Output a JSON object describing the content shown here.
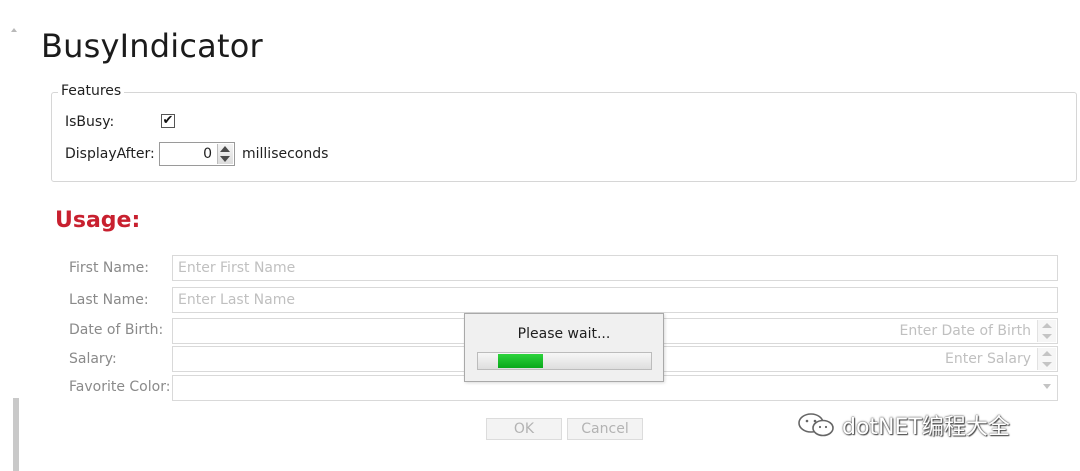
{
  "title": "BusyIndicator",
  "features": {
    "legend": "Features",
    "isbusy_label": "IsBusy:",
    "isbusy_checked": true,
    "check_glyph": "✔",
    "display_after_label": "DisplayAfter:",
    "display_after_value": "0",
    "unit_label": "milliseconds"
  },
  "usage": {
    "title": "Usage:",
    "fields": {
      "first_name": {
        "label": "First Name:",
        "placeholder": "Enter First Name"
      },
      "last_name": {
        "label": "Last Name:",
        "placeholder": "Enter Last Name"
      },
      "dob": {
        "label": "Date of Birth:",
        "placeholder": "Enter Date of Birth"
      },
      "salary": {
        "label": "Salary:",
        "placeholder": "Enter Salary"
      },
      "color": {
        "label": "Favorite Color:",
        "placeholder": ""
      }
    },
    "buttons": {
      "ok": "OK",
      "cancel": "Cancel"
    }
  },
  "busy": {
    "message": "Please wait...",
    "progress_color": "#11b824"
  },
  "watermark": {
    "text": "dotNET编程大全",
    "icon": "wechat-icon"
  },
  "colors": {
    "accent": "#c8202f"
  }
}
